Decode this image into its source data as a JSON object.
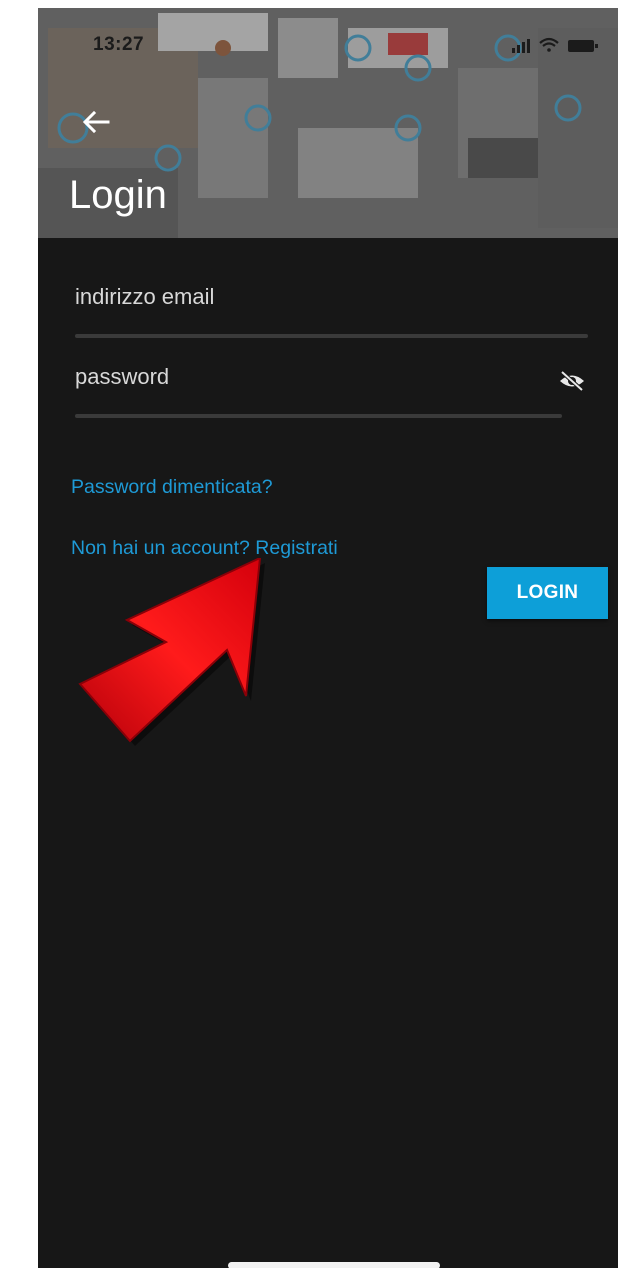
{
  "status_bar": {
    "time": "13:27"
  },
  "header": {
    "title": "Login"
  },
  "form": {
    "email_placeholder": "indirizzo email",
    "password_placeholder": "password"
  },
  "links": {
    "forgot_password": "Password dimenticata?",
    "register": "Non hai un account? Registrati"
  },
  "buttons": {
    "login": "LOGIN"
  },
  "colors": {
    "background": "#171717",
    "accent": "#0d9fd8",
    "link": "#1e9ad6",
    "annotation_arrow": "#e3000f"
  },
  "icons": {
    "back": "arrow-left-icon",
    "password_toggle": "eye-off-icon",
    "signal": "signal-icon",
    "wifi": "wifi-icon",
    "battery": "battery-icon"
  }
}
